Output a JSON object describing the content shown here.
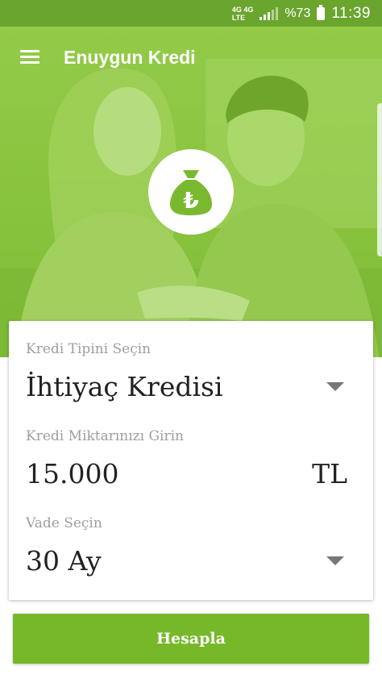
{
  "status_bar": {
    "network_top": "4G 4G",
    "network_bottom": "LTE",
    "battery_percent": "%73",
    "time": "11:39"
  },
  "toolbar": {
    "menu_icon": "hamburger-menu-icon",
    "title": "Enuygun Kredi"
  },
  "hero": {
    "badge_icon": "money-bag-lira-icon",
    "badge_symbol": "₺"
  },
  "form": {
    "loan_type_label": "Kredi Tipini Seçin",
    "loan_type_value": "İhtiyaç Kredisi",
    "amount_label": "Kredi Miktarınızı Girin",
    "amount_value": "15.000",
    "amount_unit": "TL",
    "term_label": "Vade Seçin",
    "term_value": "30 Ay"
  },
  "actions": {
    "calculate_label": "Hesapla"
  },
  "colors": {
    "brand_green": "#8cc63f",
    "status_green": "#6aa52e",
    "button_green": "#76b82a"
  }
}
